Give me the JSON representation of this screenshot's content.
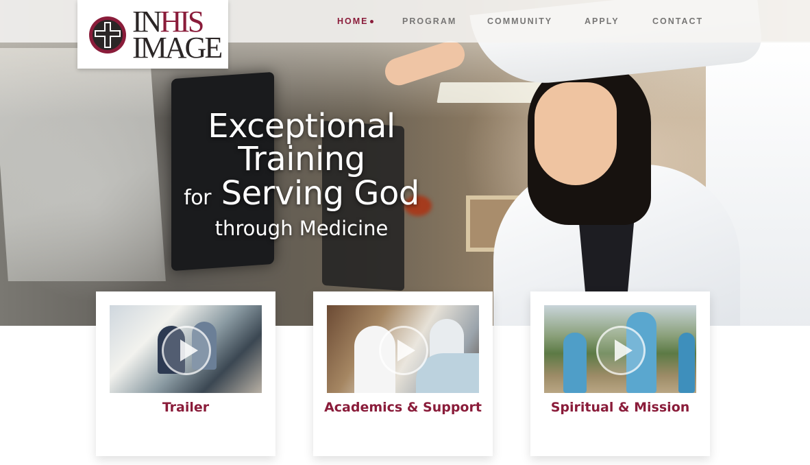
{
  "logo": {
    "line1_a": "IN",
    "line1_b": "HIS",
    "line2": "IMAGE"
  },
  "nav": {
    "items": [
      {
        "label": "HOME",
        "active": true
      },
      {
        "label": "PROGRAM"
      },
      {
        "label": "COMMUNITY"
      },
      {
        "label": "APPLY"
      },
      {
        "label": "CONTACT"
      }
    ]
  },
  "hero": {
    "line1": "Exceptional",
    "line2": "Training",
    "line3_small": "for",
    "line3_large": "Serving God",
    "line4": "through Medicine"
  },
  "cards": [
    {
      "title": "Trailer"
    },
    {
      "title": "Academics & Support"
    },
    {
      "title": "Spiritual & Mission"
    }
  ],
  "colors": {
    "brand": "#8a1c3a",
    "nav_text": "#777675"
  }
}
